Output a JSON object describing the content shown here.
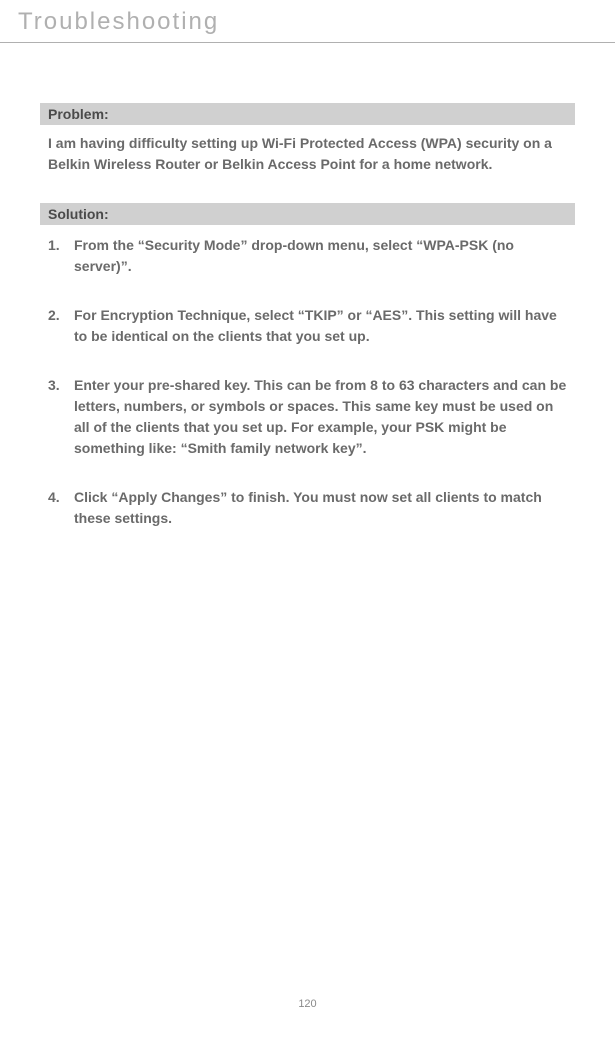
{
  "header": {
    "title": "Troubleshooting"
  },
  "problem": {
    "label": "Problem:",
    "text": "I am having difficulty setting up Wi-Fi Protected Access (WPA) security on a Belkin Wireless Router or Belkin Access Point for a home network."
  },
  "solution": {
    "label": "Solution:",
    "items": [
      {
        "number": "1.",
        "text": "From the “Security Mode” drop-down menu, select “WPA-PSK (no server)”."
      },
      {
        "number": "2.",
        "text": "For Encryption Technique, select “TKIP” or “AES”. This setting will have to be identical on the clients that you set up."
      },
      {
        "number": "3.",
        "text": "Enter your pre-shared key. This can be from 8 to 63 characters and can be letters, numbers, or symbols or spaces. This same key must be used on all of the clients that you set up. For example, your PSK might be something like: “Smith family network key”."
      },
      {
        "number": "4.",
        "text": "Click “Apply Changes” to finish. You must now set all clients to match these settings."
      }
    ]
  },
  "footer": {
    "page_number": "120"
  }
}
